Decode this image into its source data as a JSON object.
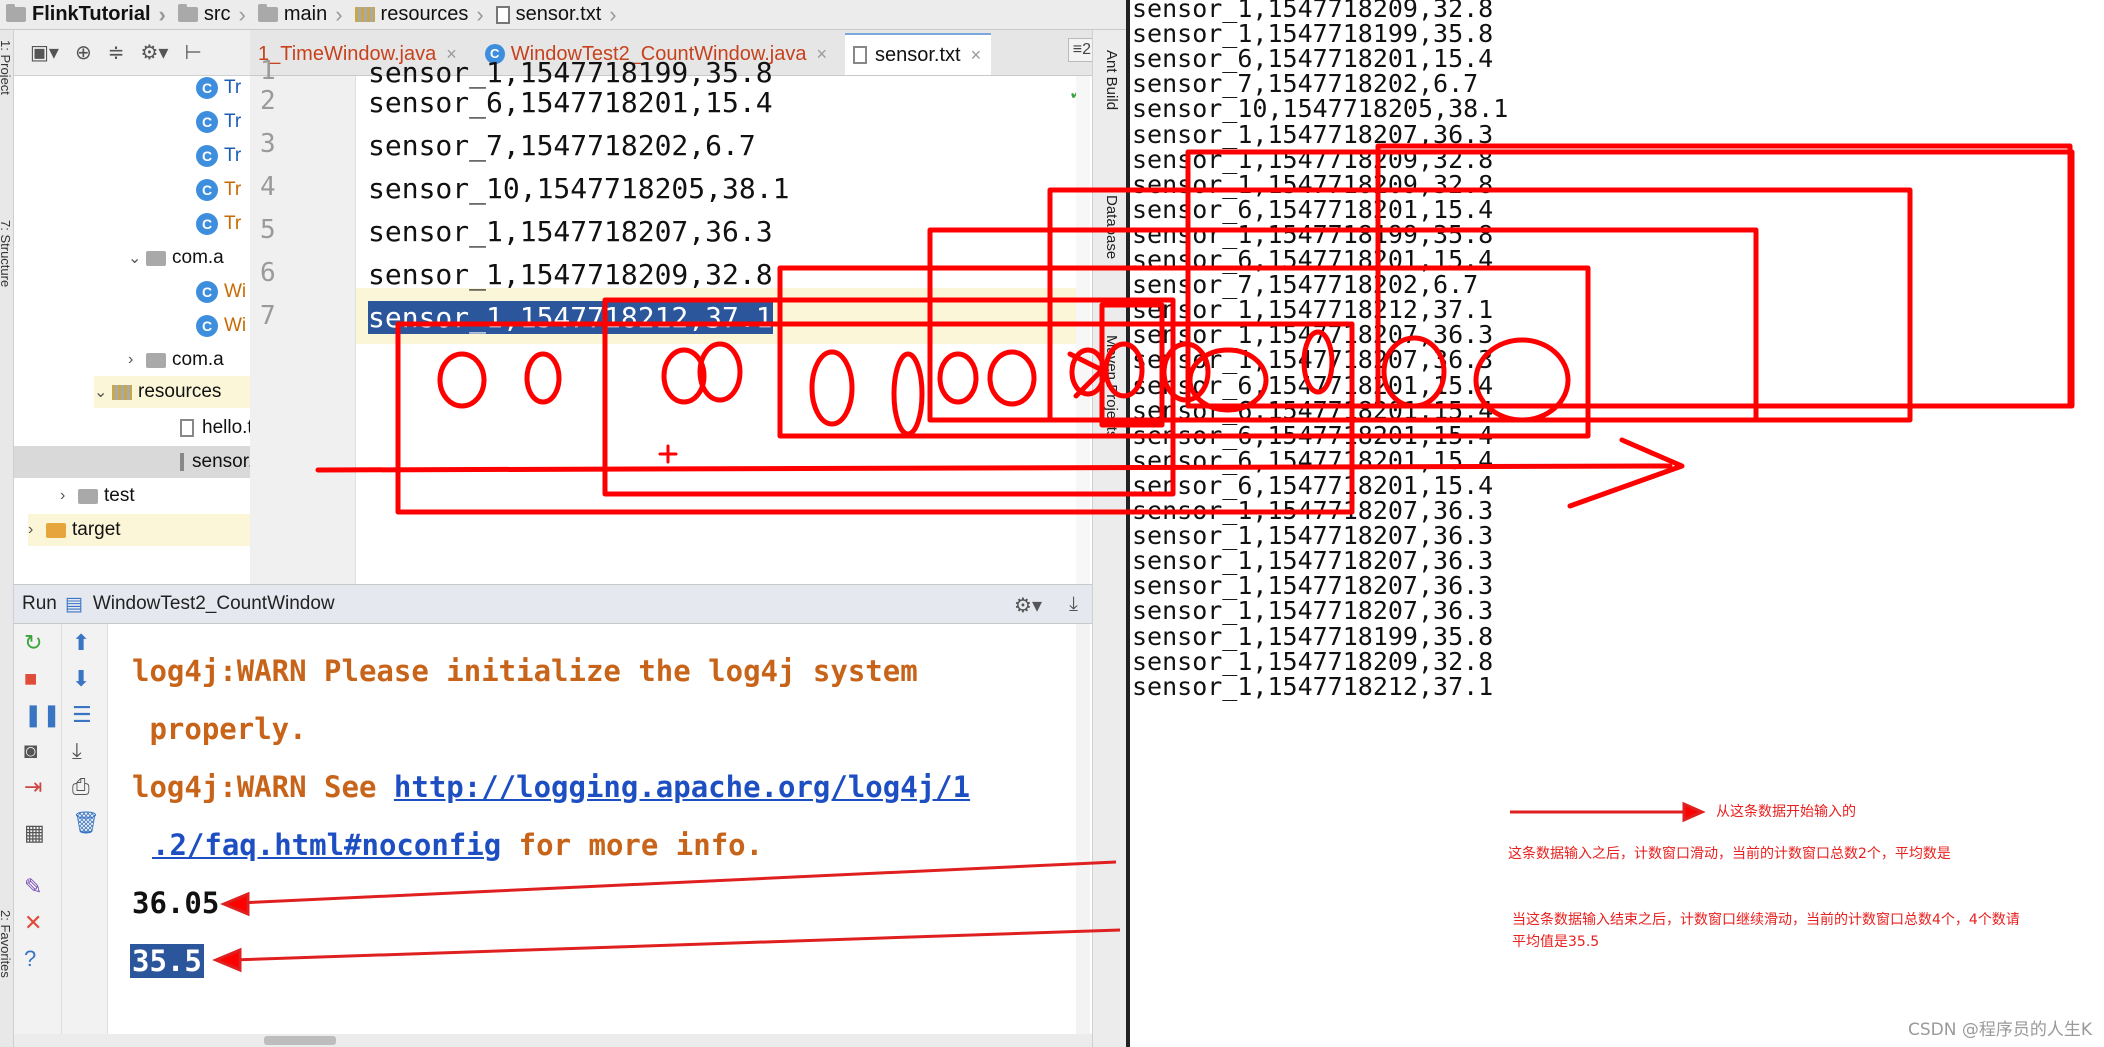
{
  "breadcrumb": [
    "FlinkTutorial",
    "src",
    "main",
    "resources",
    "sensor.txt"
  ],
  "left_strip": {
    "project_label": "1: Project",
    "structure_label": "7: Structure",
    "favorites_label": "2: Favorites"
  },
  "project_tree": {
    "class_stub": "Tr",
    "class_stub_orange": "Tr",
    "pkg1": "com.a",
    "win_stub": "Wi",
    "pkg2": "com.a",
    "resources": "resources",
    "hello": "hello.t",
    "sensor": "sensor.txt",
    "test": "test",
    "target": "target"
  },
  "editor": {
    "tabs": [
      {
        "label": "1_TimeWindow.java"
      },
      {
        "label": "WindowTest2_CountWindow.java"
      },
      {
        "label": "sensor.txt"
      }
    ],
    "tab_menu": "≡2",
    "top_partial_line": "sensor_1,1547718199,35.8",
    "lines": [
      {
        "num": "1",
        "text": ""
      },
      {
        "num": "2",
        "text": "sensor_6,1547718201,15.4"
      },
      {
        "num": "3",
        "text": "sensor_7,1547718202,6.7"
      },
      {
        "num": "4",
        "text": "sensor_10,1547718205,38.1"
      },
      {
        "num": "5",
        "text": "sensor_1,1547718207,36.3"
      },
      {
        "num": "6",
        "text": "sensor_1,1547718209,32.8"
      },
      {
        "num": "7",
        "text": "sensor_1,1547718212,37.1"
      }
    ]
  },
  "right_tool_strip": {
    "ant": "Ant Build",
    "database": "Database",
    "maven": "Maven Projects"
  },
  "run_panel": {
    "label": "Run",
    "title": "WindowTest2_CountWindow",
    "console": {
      "warn1_a": "log4j:WARN Please initialize the log4j system",
      "warn1_b": " properly.",
      "warn2_prefix": "log4j:WARN See ",
      "warn2_link_a": "http://logging.apache.org/log4j/1",
      "warn2_link_b": ".2/faq.html#noconfig",
      "warn2_suffix": " for more info.",
      "out1": "36.05",
      "out2": "35.5"
    }
  },
  "listing": [
    "sensor_1,1547718209,32.8",
    "sensor_1,1547718199,35.8",
    "sensor_6,1547718201,15.4",
    "sensor_7,1547718202,6.7",
    "sensor_10,1547718205,38.1",
    "sensor_1,1547718207,36.3",
    "sensor_1,1547718209,32.8",
    "sensor_1,1547718209,32.8",
    "sensor_6,1547718201,15.4",
    "sensor_1,1547718199,35.8",
    "sensor_6,1547718201,15.4",
    "sensor_7,1547718202,6.7",
    "sensor_1,1547718212,37.1",
    "sensor_1,1547718207,36.3",
    "sensor_1,1547718207,36.3",
    "sensor_6,1547718201,15.4",
    "sensor_6,1547718201,15.4",
    "sensor_6,1547718201,15.4",
    "sensor_6,1547718201,15.4",
    "sensor_6,1547718201,15.4",
    "sensor_1,1547718207,36.3",
    "sensor_1,1547718207,36.3",
    "sensor_1,1547718207,36.3",
    "sensor_1,1547718207,36.3",
    "sensor_1,1547718207,36.3",
    "sensor_1,1547718199,35.8",
    "sensor_1,1547718209,32.8",
    "sensor_1,1547718212,37.1"
  ],
  "notes": {
    "n1": "从这条数据开始输入的",
    "n2": "这条数据输入之后，计数窗口滑动，当前的计数窗口总数2个，平均数是",
    "n3a": "当这条数据输入结束之后，计数窗口继续滑动，当前的计数窗口总数4个，4个数请",
    "n3b": "平均值是35.5"
  },
  "watermark": "CSDN @程序员的人生K",
  "colors": {
    "annotation_red": "#ff0000",
    "selection_blue": "#2c569c",
    "warn_orange": "#c8641a",
    "link_blue": "#1e4fc2"
  }
}
